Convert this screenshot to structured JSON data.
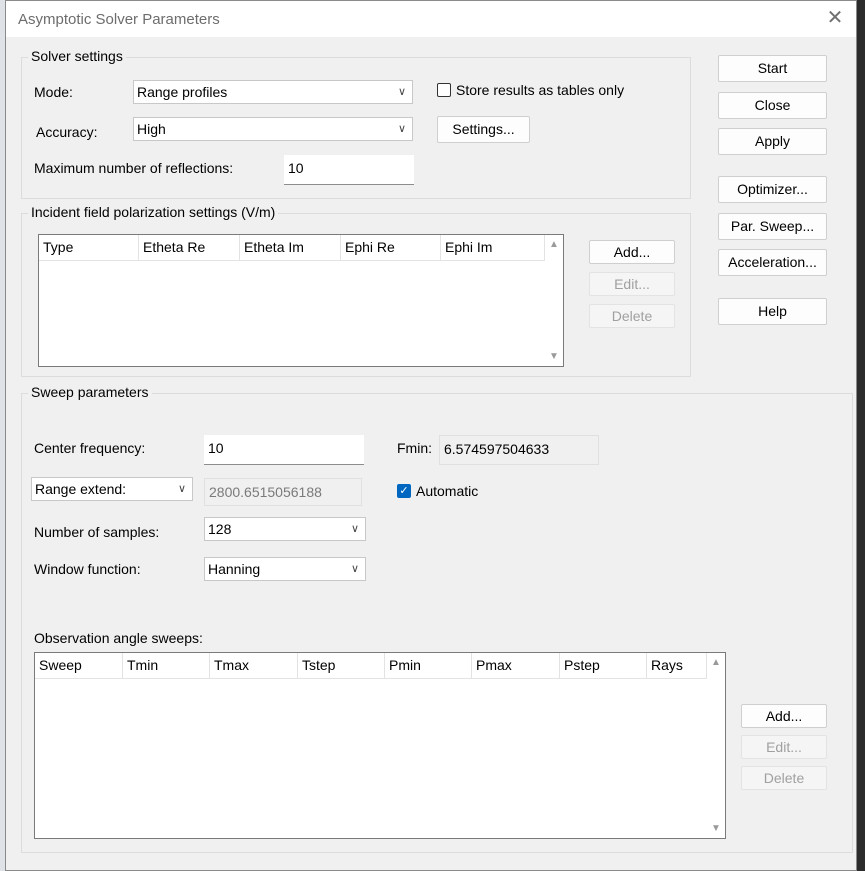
{
  "window": {
    "title": "Asymptotic Solver Parameters",
    "close_glyph": "✕"
  },
  "solver_settings": {
    "title": "Solver settings",
    "mode_label": "Mode:",
    "mode_value": "Range profiles",
    "store_results_label": "Store results as tables only",
    "store_results_checked": false,
    "accuracy_label": "Accuracy:",
    "accuracy_value": "High",
    "settings_button": "Settings...",
    "max_reflections_label": "Maximum number of reflections:",
    "max_reflections_value": "10"
  },
  "right_buttons": {
    "start": "Start",
    "close": "Close",
    "apply": "Apply",
    "optimizer": "Optimizer...",
    "par_sweep": "Par. Sweep...",
    "acceleration": "Acceleration...",
    "help": "Help"
  },
  "incident_field": {
    "title": "Incident field polarization settings (V/m)",
    "columns": [
      "Type",
      "Etheta Re",
      "Etheta Im",
      "Ephi Re",
      "Ephi Im"
    ],
    "add": "Add...",
    "edit": "Edit...",
    "delete": "Delete"
  },
  "sweep": {
    "title": "Sweep parameters",
    "center_freq_label": "Center frequency:",
    "center_freq_value": "10",
    "fmin_label": "Fmin:",
    "fmin_value": "6.574597504633",
    "range_extend_option": "Range extend:",
    "range_extend_value": "2800.6515056188",
    "automatic_label": "Automatic",
    "automatic_checked": true,
    "num_samples_label": "Number of samples:",
    "num_samples_value": "128",
    "window_function_label": "Window function:",
    "window_function_value": "Hanning",
    "observation_label": "Observation angle sweeps:",
    "obs_columns": [
      "Sweep",
      "Tmin",
      "Tmax",
      "Tstep",
      "Pmin",
      "Pmax",
      "Pstep",
      "Rays"
    ],
    "add": "Add...",
    "edit": "Edit...",
    "delete": "Delete"
  },
  "icons": {
    "dropdown": "chevron-down-icon",
    "scroll_up": "scroll-up-icon",
    "scroll_down": "scroll-down-icon",
    "check": "check-icon"
  }
}
